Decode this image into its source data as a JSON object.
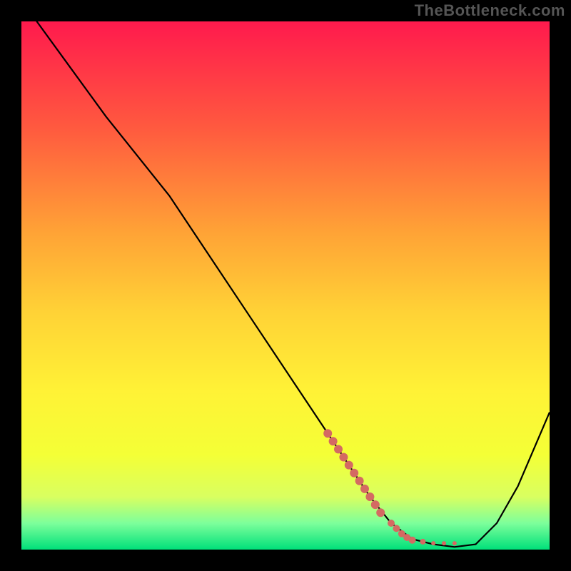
{
  "watermark": "TheBottleneck.com",
  "chart_data": {
    "type": "line",
    "title": "",
    "xlabel": "",
    "ylabel": "",
    "xlim": [
      0,
      100
    ],
    "ylim": [
      0,
      100
    ],
    "gradient_stops": [
      {
        "offset": 0,
        "color": "#ff1a4d"
      },
      {
        "offset": 20,
        "color": "#ff593f"
      },
      {
        "offset": 40,
        "color": "#ffa336"
      },
      {
        "offset": 55,
        "color": "#ffd236"
      },
      {
        "offset": 70,
        "color": "#fff236"
      },
      {
        "offset": 82,
        "color": "#f4ff36"
      },
      {
        "offset": 90,
        "color": "#d9ff60"
      },
      {
        "offset": 95,
        "color": "#7dff9b"
      },
      {
        "offset": 100,
        "color": "#00e07a"
      }
    ],
    "series": [
      {
        "name": "bottleneck-curve",
        "stroke": "#000000",
        "x": [
          0,
          8,
          16,
          24,
          28,
          36,
          44,
          52,
          60,
          66,
          70,
          74,
          78,
          82,
          86,
          90,
          94,
          100
        ],
        "y": [
          104,
          93,
          82,
          72,
          67,
          55,
          43,
          31,
          19,
          10,
          5,
          2,
          1,
          0.5,
          1,
          5,
          12,
          26
        ]
      }
    ],
    "highlight_points": {
      "name": "highlight",
      "color": "#d46a62",
      "x": [
        58,
        59,
        60,
        61,
        62,
        63,
        64,
        65,
        66,
        67,
        68,
        70,
        71,
        72,
        73,
        74,
        76,
        78,
        80,
        82
      ],
      "y": [
        22,
        20.5,
        19,
        17.5,
        16,
        14.5,
        13,
        11.5,
        10,
        8.5,
        7,
        5,
        4,
        3,
        2.3,
        1.8,
        1.5,
        1.2,
        1.2,
        1.2
      ],
      "r": [
        6,
        6,
        6,
        6,
        6,
        6,
        6,
        6,
        6,
        6,
        6,
        5,
        5,
        5,
        5,
        5,
        4,
        3,
        3,
        3
      ]
    }
  }
}
